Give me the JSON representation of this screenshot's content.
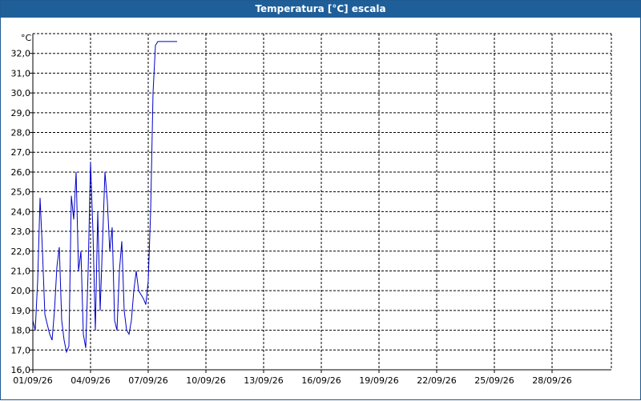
{
  "window": {
    "title": "Temperatura [°C] escala"
  },
  "colors": {
    "titlebar": "#1f5f99",
    "line": "#0000c8",
    "grid": "#000000"
  },
  "chart_data": {
    "type": "line",
    "title": "Temperatura [°C] escala",
    "ylabel": "°C",
    "xlabel": "",
    "ylim": [
      16.0,
      33.0
    ],
    "xlim": [
      "01/09/26",
      "01/10/26"
    ],
    "y_ticks": [
      "16,0",
      "17,0",
      "18,0",
      "19,0",
      "20,0",
      "21,0",
      "22,0",
      "23,0",
      "24,0",
      "25,0",
      "26,0",
      "27,0",
      "28,0",
      "29,0",
      "30,0",
      "31,0",
      "32,0"
    ],
    "x_ticks": [
      "01/09/26",
      "04/09/26",
      "07/09/26",
      "10/09/26",
      "13/09/26",
      "16/09/26",
      "19/09/26",
      "22/09/26",
      "25/09/26",
      "28/09/26"
    ],
    "grid": true,
    "series": [
      {
        "x": [
          "01/09 00:00",
          "01/09 03:00",
          "01/09 06:00",
          "01/09 09:00",
          "01/09 12:00",
          "01/09 15:00",
          "01/09 18:00",
          "01/09 21:00",
          "02/09 00:00",
          "02/09 03:00",
          "02/09 06:00",
          "02/09 09:00",
          "02/09 12:00",
          "02/09 15:00",
          "02/09 18:00",
          "02/09 21:00",
          "03/09 00:00",
          "03/09 03:00",
          "03/09 06:00",
          "03/09 09:00",
          "03/09 12:00",
          "03/09 15:00",
          "03/09 18:00",
          "03/09 21:00",
          "04/09 00:00",
          "04/09 03:00",
          "04/09 06:00",
          "04/09 09:00",
          "04/09 12:00",
          "04/09 15:00",
          "04/09 18:00",
          "04/09 21:00",
          "05/09 00:00",
          "05/09 03:00",
          "05/09 06:00",
          "05/09 09:00",
          "05/09 12:00",
          "05/09 15:00",
          "05/09 18:00",
          "05/09 21:00",
          "06/09 00:00",
          "06/09 03:00",
          "06/09 06:00",
          "06/09 09:00",
          "06/09 12:00",
          "06/09 15:00",
          "06/09 18:00",
          "06/09 21:00",
          "07/09 00:00",
          "07/09 03:00",
          "07/09 06:00",
          "07/09 09:00",
          "07/09 12:00",
          "07/09 15:00",
          "07/09 18:00",
          "07/09 21:00",
          "08/09 00:00",
          "08/09 03:00",
          "08/09 06:00",
          "08/09 09:00",
          "08/09 12:00",
          "08/09 15:00",
          "08/09 18:00",
          "08/09 21:00",
          "09/09 00:00"
        ],
        "y": [
          18.5,
          18.0,
          20.5,
          24.7,
          22.0,
          18.8,
          18.3,
          17.8,
          17.5,
          19.0,
          21.2,
          22.2,
          18.5,
          17.5,
          16.9,
          17.2,
          24.8,
          23.6,
          26.0,
          21.0,
          22.0,
          17.8,
          17.1,
          21.0,
          26.5,
          23.0,
          18.0,
          24.0,
          19.0,
          22.5,
          26.0,
          24.5,
          22.0,
          23.2,
          18.5,
          18.0,
          21.0,
          22.5,
          19.0,
          18.0,
          17.8,
          18.5,
          20.0,
          21.0,
          20.0,
          19.8,
          19.6,
          19.3,
          20.5,
          24.0,
          30.0,
          32.4,
          32.6,
          32.6,
          32.6,
          32.6,
          32.6,
          32.6,
          32.6,
          32.6,
          32.6,
          32.6,
          32.6,
          32.6,
          32.6
        ]
      }
    ]
  }
}
